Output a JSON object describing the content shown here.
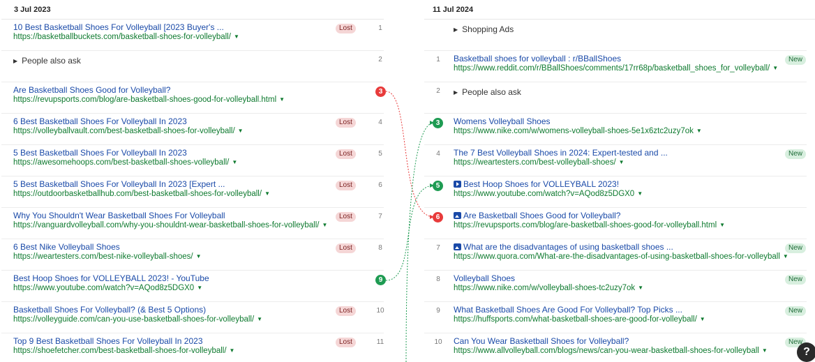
{
  "left": {
    "date": "3 Jul 2023",
    "rows": [
      {
        "kind": "result",
        "title": "10 Best Basketball Shoes For Volleyball [2023 Buyer's ...",
        "url": "https://basketballbuckets.com/basketball-shoes-for-volleyball/",
        "tag": "Lost",
        "pos": "1"
      },
      {
        "kind": "feature",
        "title": "People also ask",
        "pos": "2"
      },
      {
        "kind": "result",
        "title": "Are Basketball Shoes Good for Volleyball?",
        "url": "https://revupsports.com/blog/are-basketball-shoes-good-for-volleyball.html",
        "badge": "3",
        "badge_color": "red"
      },
      {
        "kind": "result",
        "title": "6 Best Basketball Shoes For Volleyball In 2023",
        "url": "https://volleyballvault.com/best-basketball-shoes-for-volleyball/",
        "tag": "Lost",
        "pos": "4"
      },
      {
        "kind": "result",
        "title": "5 Best Basketball Shoes For Volleyball In 2023",
        "url": "https://awesomehoops.com/best-basketball-shoes-volleyball/",
        "tag": "Lost",
        "pos": "5"
      },
      {
        "kind": "result",
        "title": "5 Best Basketball Shoes For Volleyball In 2023 [Expert ...",
        "url": "https://outdoorbasketballhub.com/best-basketball-shoes-for-volleyball/",
        "tag": "Lost",
        "pos": "6"
      },
      {
        "kind": "result",
        "title": "Why You Shouldn't Wear Basketball Shoes For Volleyball",
        "url": "https://vanguardvolleyball.com/why-you-shouldnt-wear-basketball-shoes-for-volleyball/",
        "tag": "Lost",
        "pos": "7"
      },
      {
        "kind": "result",
        "title": "6 Best Nike Volleyball Shoes",
        "url": "https://weartesters.com/best-nike-volleyball-shoes/",
        "tag": "Lost",
        "pos": "8"
      },
      {
        "kind": "result",
        "title": "Best Hoop Shoes for VOLLEYBALL 2023! - YouTube",
        "url": "https://www.youtube.com/watch?v=AQod8z5DGX0",
        "badge": "9",
        "badge_color": "green"
      },
      {
        "kind": "result",
        "title": "Basketball Shoes For Volleyball? (& Best 5 Options)",
        "url": "https://volleyguide.com/can-you-use-basketball-shoes-for-volleyball/",
        "tag": "Lost",
        "pos": "10"
      },
      {
        "kind": "result",
        "title": "Top 9 Best Basketball Shoes For Volleyball In 2023",
        "url": "https://shoefetcher.com/best-basketball-shoes-for-volleyball/",
        "tag": "Lost",
        "pos": "11"
      }
    ]
  },
  "right": {
    "date": "11 Jul 2024",
    "rows": [
      {
        "kind": "feature",
        "title": "Shopping Ads"
      },
      {
        "kind": "result",
        "title": "Basketball shoes for volleyball : r/BBallShoes",
        "url": "https://www.reddit.com/r/BBallShoes/comments/17rr68p/basketball_shoes_for_volleyball/",
        "tag": "New",
        "pos": "1"
      },
      {
        "kind": "feature",
        "title": "People also ask",
        "pos": "2"
      },
      {
        "kind": "result",
        "title": "Womens Volleyball Shoes",
        "url": "https://www.nike.com/w/womens-volleyball-shoes-5e1x6ztc2uzy7ok",
        "badge": "3",
        "badge_color": "green"
      },
      {
        "kind": "result",
        "title": "The 7 Best Volleyball Shoes in 2024: Expert-tested and ...",
        "url": "https://weartesters.com/best-volleyball-shoes/",
        "tag": "New",
        "pos": "4"
      },
      {
        "kind": "result",
        "title": "Best Hoop Shoes for VOLLEYBALL 2023!",
        "url": "https://www.youtube.com/watch?v=AQod8z5DGX0",
        "badge": "5",
        "badge_color": "green",
        "icon": "video-icon"
      },
      {
        "kind": "result",
        "title": "Are Basketball Shoes Good for Volleyball?",
        "url": "https://revupsports.com/blog/are-basketball-shoes-good-for-volleyball.html",
        "badge": "6",
        "badge_color": "red",
        "icon": "image-icon"
      },
      {
        "kind": "result",
        "title": "What are the disadvantages of using basketball shoes ...",
        "url": "https://www.quora.com/What-are-the-disadvantages-of-using-basketball-shoes-for-volleyball",
        "tag": "New",
        "pos": "7",
        "icon": "image-icon"
      },
      {
        "kind": "result",
        "title": "Volleyball Shoes",
        "url": "https://www.nike.com/w/volleyball-shoes-tc2uzy7ok",
        "tag": "New",
        "pos": "8"
      },
      {
        "kind": "result",
        "title": "What Basketball Shoes Are Good For Volleyball? Top Picks ...",
        "url": "https://huffsports.com/what-basketball-shoes-are-good-for-volleyball/",
        "tag": "New",
        "pos": "9"
      },
      {
        "kind": "result",
        "title": "Can You Wear Basketball Shoes for Volleyball?",
        "url": "https://www.allvolleyball.com/blogs/news/can-you-wear-basketball-shoes-for-volleyball",
        "tag": "New",
        "pos": "10"
      }
    ]
  },
  "help": {
    "label": "?"
  },
  "colors": {
    "lost": "#f5d6d6",
    "new": "#d8efdf",
    "red": "#e83b3b",
    "green": "#1e9b52",
    "link": "#1a4aa8",
    "url": "#0e7a2f"
  }
}
